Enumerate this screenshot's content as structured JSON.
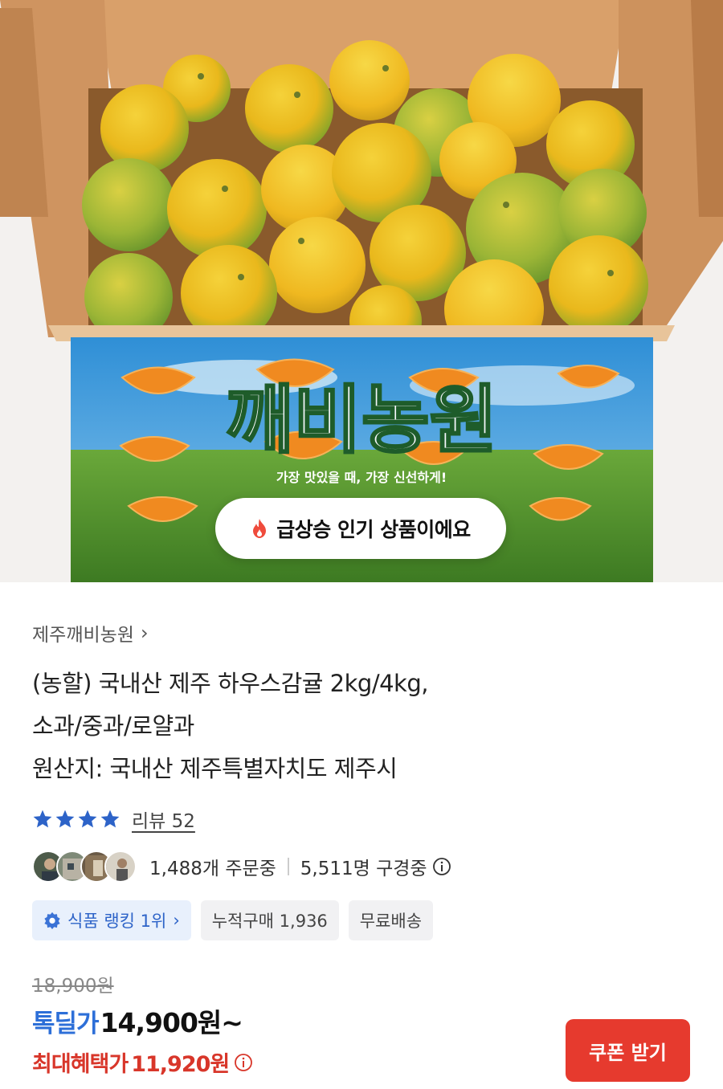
{
  "hero": {
    "box_brand": "깨비농원",
    "box_slogan": "가장 맛있을 때, 가장 신선하게!",
    "trend_badge": "급상승 인기 상품이에요"
  },
  "product": {
    "seller": "제주깨비농원",
    "seller_chevron": "›",
    "title_lines": [
      "(농할) 국내산 제주 하우스감귤 2kg/4kg,",
      "소과/중과/로얄과",
      "원산지: 국내산 제주특별자치도 제주시"
    ],
    "rating_stars": 4,
    "review_label": "리뷰 52",
    "orders_label": "1,488개 주문중",
    "viewers_label": "5,511명 구경중",
    "chips": {
      "ranking": "식품 랭킹 1위",
      "ranking_chevron": "›",
      "cumulative": "누적구매 1,936",
      "shipping": "무료배송"
    },
    "original_price": "18,900원",
    "deal_label": "톡딜가",
    "deal_price": "14,900원~",
    "max_benefit_label": "최대혜택가",
    "max_benefit_price": "11,920원",
    "coupon_button": "쿠폰 받기"
  },
  "colors": {
    "deal_blue": "#2d6fd8",
    "benefit_red": "#d8362a",
    "coupon_red": "#e63a2e",
    "star_blue": "#2d63c8"
  }
}
